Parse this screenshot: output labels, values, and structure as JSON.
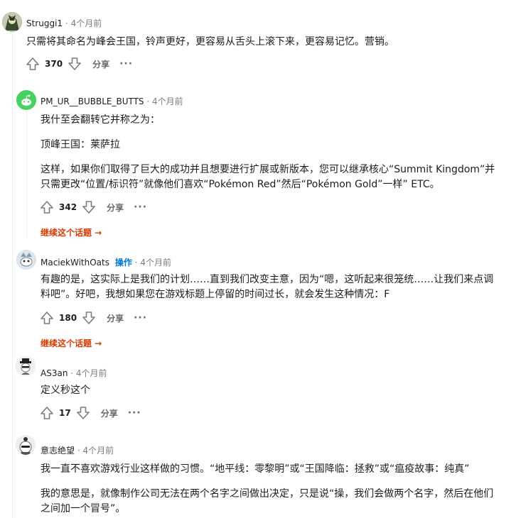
{
  "comments": [
    {
      "author": "Struggi1",
      "op_label": "",
      "time": "4个月前",
      "paragraphs": [
        "只需将其命名为峰会王国，铃声更好，更容易从舌头上滚下来，更容易记忆。营销。"
      ],
      "score": "370",
      "share": "分享",
      "more": "···"
    },
    {
      "author": "PM_UR__BUBBLE_BUTTS",
      "op_label": "",
      "time": "4个月前",
      "paragraphs": [
        "我什至会翻转它并称之为：",
        "顶峰王国：莱萨拉",
        "这样，如果你们取得了巨大的成功并且想要进行扩展或新版本，您可以继承核心“Summit Kingdom”并只需更改“位置/标识符”就像他们喜欢“Pokémon Red”然后“Pokémon Gold”一样” ETC。"
      ],
      "score": "342",
      "share": "分享",
      "more": "···",
      "continue": "继续这个话题 →"
    },
    {
      "author": "MaciekWithOats",
      "op_label": "操作",
      "time": "4个月前",
      "paragraphs": [
        "有趣的是，这实际上是我们的计划……直到我们改变主意，因为“嗯，这听起来很笼统……让我们来点调料吧”。好吧，我想如果您在游戏标题上停留的时间过长，就会发生这种情况：F"
      ],
      "score": "180",
      "share": "分享",
      "more": "···",
      "continue": "继续这个话题 →"
    },
    {
      "author": "AS3an",
      "op_label": "",
      "time": "4个月前",
      "paragraphs": [
        "定义秒这个"
      ],
      "score": "17",
      "share": "分享",
      "more": "···"
    },
    {
      "author": "意志绝望",
      "op_label": "",
      "time": "4个月前",
      "paragraphs": [
        "我一直不喜欢游戏行业这样做的习惯。“地平线：零黎明”或“王国降临：拯救”或“瘟疫故事：纯真”",
        "我的意思是，就像制作公司无法在两个名字之间做出决定，只是说“操，我们会做两个名字，然后在他们之间加一个冒号”。"
      ]
    }
  ],
  "separator": "·",
  "icons": {
    "upvote": "upvote-arrow-icon",
    "downvote": "downvote-arrow-icon",
    "more": "more-dots-icon"
  },
  "colors": {
    "op": "#0079d3",
    "continue": "#d93a00",
    "meta": "#7c7c7c"
  }
}
